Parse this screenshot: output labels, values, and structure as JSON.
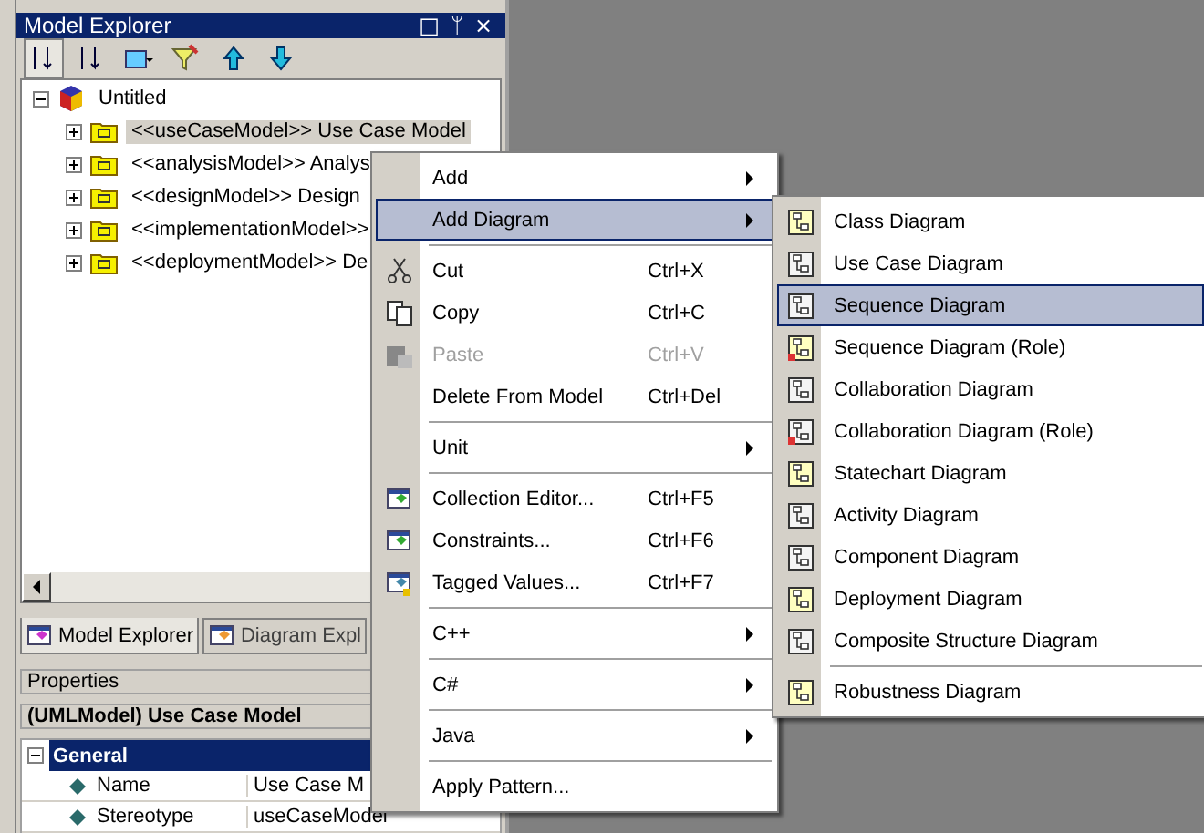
{
  "panel": {
    "title": "Model Explorer",
    "title_buttons": [
      "□",
      "ᛘ",
      "×"
    ]
  },
  "tree": {
    "label": "Untitled",
    "expanded": true,
    "children": [
      {
        "label": "<<useCaseModel>> Use Case Model",
        "expanded": false,
        "selected": true
      },
      {
        "label": "<<analysisModel>> Analys",
        "expanded": false,
        "selected": false
      },
      {
        "label": "<<designModel>> Design",
        "expanded": false,
        "selected": false
      },
      {
        "label": "<<implementationModel>>",
        "expanded": false,
        "selected": false
      },
      {
        "label": "<<deploymentModel>> De",
        "expanded": false,
        "selected": false
      }
    ]
  },
  "bottom_tabs": [
    {
      "label": "Model Explorer",
      "selected": true
    },
    {
      "label": "Diagram Expl",
      "selected": false
    }
  ],
  "properties": {
    "header": "Properties",
    "element": "(UMLModel) Use Case Model",
    "group": "General",
    "expanded": true,
    "rows": [
      {
        "name": "Name",
        "value": "Use Case M"
      },
      {
        "name": "Stereotype",
        "value": "useCaseModel"
      }
    ]
  },
  "context_menu": [
    {
      "kind": "submenu",
      "label": "Add",
      "selected": false,
      "disabled": false
    },
    {
      "kind": "submenu",
      "label": "Add Diagram",
      "selected": true,
      "disabled": false
    },
    {
      "kind": "separator"
    },
    {
      "kind": "command",
      "label": "Cut",
      "shortcut": "Ctrl+X",
      "selected": false,
      "disabled": false
    },
    {
      "kind": "command",
      "label": "Copy",
      "shortcut": "Ctrl+C",
      "selected": false,
      "disabled": false
    },
    {
      "kind": "command",
      "label": "Paste",
      "shortcut": "Ctrl+V",
      "selected": false,
      "disabled": true
    },
    {
      "kind": "command",
      "label": "Delete From Model",
      "shortcut": "Ctrl+Del",
      "selected": false,
      "disabled": false
    },
    {
      "kind": "separator"
    },
    {
      "kind": "submenu",
      "label": "Unit",
      "selected": false,
      "disabled": false
    },
    {
      "kind": "separator"
    },
    {
      "kind": "command",
      "label": "Collection Editor...",
      "shortcut": "Ctrl+F5",
      "selected": false,
      "disabled": false
    },
    {
      "kind": "command",
      "label": "Constraints...",
      "shortcut": "Ctrl+F6",
      "selected": false,
      "disabled": false
    },
    {
      "kind": "command",
      "label": "Tagged Values...",
      "shortcut": "Ctrl+F7",
      "selected": false,
      "disabled": false
    },
    {
      "kind": "separator"
    },
    {
      "kind": "submenu",
      "label": "C++",
      "selected": false,
      "disabled": false
    },
    {
      "kind": "separator"
    },
    {
      "kind": "submenu",
      "label": "C#",
      "selected": false,
      "disabled": false
    },
    {
      "kind": "separator"
    },
    {
      "kind": "submenu",
      "label": "Java",
      "selected": false,
      "disabled": false
    },
    {
      "kind": "separator"
    },
    {
      "kind": "command",
      "label": "Apply Pattern...",
      "selected": false,
      "disabled": false
    }
  ],
  "submenu": [
    {
      "kind": "command",
      "label": "Class Diagram",
      "selected": false
    },
    {
      "kind": "command",
      "label": "Use Case Diagram",
      "selected": false
    },
    {
      "kind": "command",
      "label": "Sequence Diagram",
      "selected": true
    },
    {
      "kind": "command",
      "label": "Sequence Diagram (Role)",
      "selected": false
    },
    {
      "kind": "command",
      "label": "Collaboration Diagram",
      "selected": false
    },
    {
      "kind": "command",
      "label": "Collaboration Diagram (Role)",
      "selected": false
    },
    {
      "kind": "command",
      "label": "Statechart Diagram",
      "selected": false
    },
    {
      "kind": "command",
      "label": "Activity Diagram",
      "selected": false
    },
    {
      "kind": "command",
      "label": "Component Diagram",
      "selected": false
    },
    {
      "kind": "command",
      "label": "Deployment Diagram",
      "selected": false
    },
    {
      "kind": "command",
      "label": "Composite Structure Diagram",
      "selected": false
    },
    {
      "kind": "separator"
    },
    {
      "kind": "command",
      "label": "Robustness Diagram",
      "selected": false
    }
  ]
}
